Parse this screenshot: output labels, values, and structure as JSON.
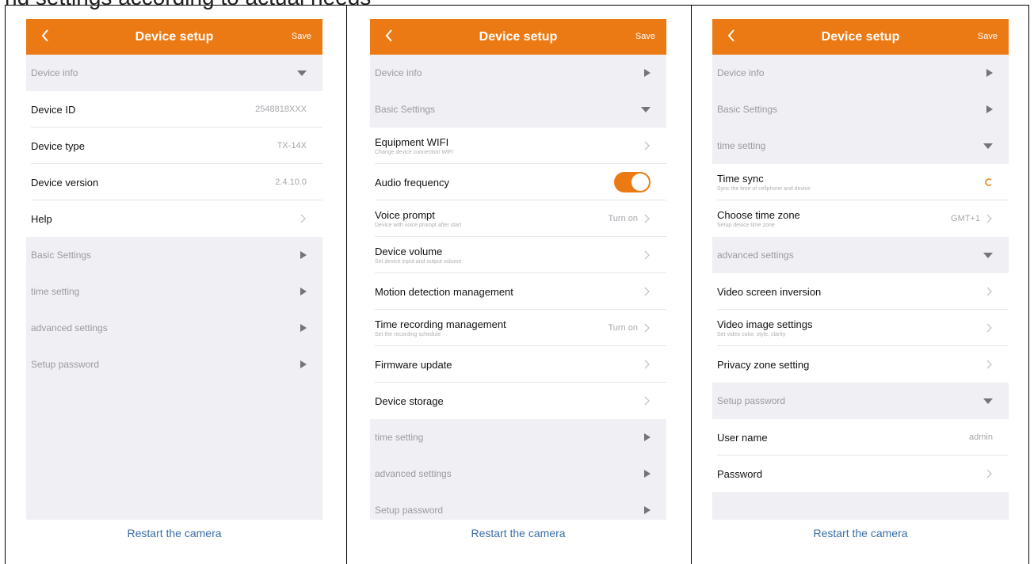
{
  "header_text": "nd settings according to actual needs",
  "colors": {
    "accent": "#ec7a14",
    "section_bg": "#efeff4",
    "link": "#3a6ea5"
  },
  "icons": {
    "back": "chevron-left-icon",
    "expanded": "triangle-down-icon",
    "collapsed": "triangle-right-icon",
    "arrow": "chevron-right-icon",
    "sync": "sync-icon"
  },
  "screens": [
    {
      "title": "Device setup",
      "save_label": "Save",
      "rows": [
        {
          "type": "section",
          "label": "Device info",
          "state": "expanded"
        },
        {
          "type": "item",
          "label": "Device ID",
          "value": "2548818XXX",
          "arrow": false
        },
        {
          "type": "item",
          "label": "Device type",
          "value": "TX-14X",
          "arrow": false
        },
        {
          "type": "item",
          "label": "Device version",
          "value": "2.4.10.0",
          "arrow": false
        },
        {
          "type": "item",
          "label": "Help",
          "arrow": true,
          "last": true
        },
        {
          "type": "section",
          "label": "Basic Settings",
          "state": "collapsed"
        },
        {
          "type": "section",
          "label": "time setting",
          "state": "collapsed"
        },
        {
          "type": "section",
          "label": "advanced settings",
          "state": "collapsed"
        },
        {
          "type": "section",
          "label": "Setup password",
          "state": "collapsed"
        }
      ],
      "footer": "Restart the camera"
    },
    {
      "title": "Device setup",
      "save_label": "Save",
      "rows": [
        {
          "type": "section",
          "label": "Device info",
          "state": "collapsed"
        },
        {
          "type": "section",
          "label": "Basic Settings",
          "state": "expanded"
        },
        {
          "type": "item",
          "label": "Equipment WIFI",
          "sub": "Change device connection WIFI",
          "arrow": true
        },
        {
          "type": "item",
          "label": "Audio frequency",
          "toggle": true,
          "toggle_on": true
        },
        {
          "type": "item",
          "label": "Voice prompt",
          "sub": "Device with voice prompt after start",
          "value": "Turn on",
          "arrow": true
        },
        {
          "type": "item",
          "label": "Device volume",
          "sub": "Set device input and output volume",
          "arrow": true
        },
        {
          "type": "item",
          "label": "Motion detection management",
          "arrow": true
        },
        {
          "type": "item",
          "label": "Time recording management",
          "sub": "Set the recording schedule",
          "value": "Turn on",
          "arrow": true
        },
        {
          "type": "item",
          "label": "Firmware update",
          "arrow": true
        },
        {
          "type": "item",
          "label": "Device storage",
          "arrow": true,
          "last": true
        },
        {
          "type": "section",
          "label": "time setting",
          "state": "collapsed"
        },
        {
          "type": "section",
          "label": "advanced settings",
          "state": "collapsed"
        },
        {
          "type": "section",
          "label": "Setup password",
          "state": "collapsed"
        }
      ],
      "footer": "Restart the camera"
    },
    {
      "title": "Device setup",
      "save_label": "Save",
      "rows": [
        {
          "type": "section",
          "label": "Device info",
          "state": "collapsed"
        },
        {
          "type": "section",
          "label": "Basic Settings",
          "state": "collapsed"
        },
        {
          "type": "section",
          "label": "time setting",
          "state": "expanded"
        },
        {
          "type": "item",
          "label": "Time sync",
          "sub": "Sync the time of cellphone and device",
          "sync": true
        },
        {
          "type": "item",
          "label": "Choose time zone",
          "sub": "Setup device time zone",
          "value": "GMT+1",
          "arrow": true,
          "last": true
        },
        {
          "type": "section",
          "label": "advanced settings",
          "state": "expanded"
        },
        {
          "type": "item",
          "label": "Video screen inversion",
          "arrow": true
        },
        {
          "type": "item",
          "label": "Video image settings",
          "sub": "Set video color, style, clarity",
          "arrow": true
        },
        {
          "type": "item",
          "label": "Privacy zone setting",
          "arrow": true,
          "last": true
        },
        {
          "type": "section",
          "label": "Setup password",
          "state": "expanded"
        },
        {
          "type": "item",
          "label": "User name",
          "value": "admin",
          "arrow": false
        },
        {
          "type": "item",
          "label": "Password",
          "arrow": true,
          "last": true
        }
      ],
      "footer": "Restart the camera"
    }
  ]
}
